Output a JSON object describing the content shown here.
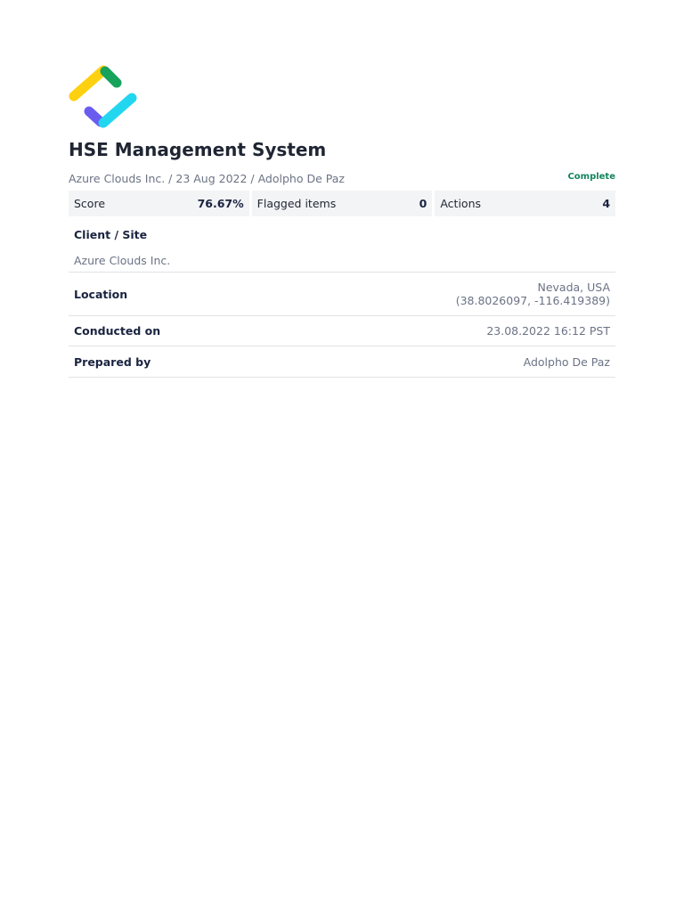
{
  "header": {
    "title": "HSE Management System",
    "subtitle": "Azure Clouds Inc. / 23 Aug 2022 / Adolpho De Paz",
    "status": "Complete",
    "logo_colors": [
      "#fdd10f",
      "#17a35c",
      "#23d6f0",
      "#6b5cf0"
    ]
  },
  "stats": [
    {
      "label": "Score",
      "value": "76.67%"
    },
    {
      "label": "Flagged items",
      "value": "0"
    },
    {
      "label": "Actions",
      "value": "4"
    }
  ],
  "details": {
    "client_label": "Client / Site",
    "client_value": "Azure Clouds Inc.",
    "location_label": "Location",
    "location_value": "Nevada, USA",
    "location_coords": "(38.8026097, -116.419389)",
    "conducted_label": "Conducted on",
    "conducted_value": "23.08.2022 16:12 PST",
    "prepared_label": "Prepared by",
    "prepared_value": "Adolpho De Paz"
  }
}
